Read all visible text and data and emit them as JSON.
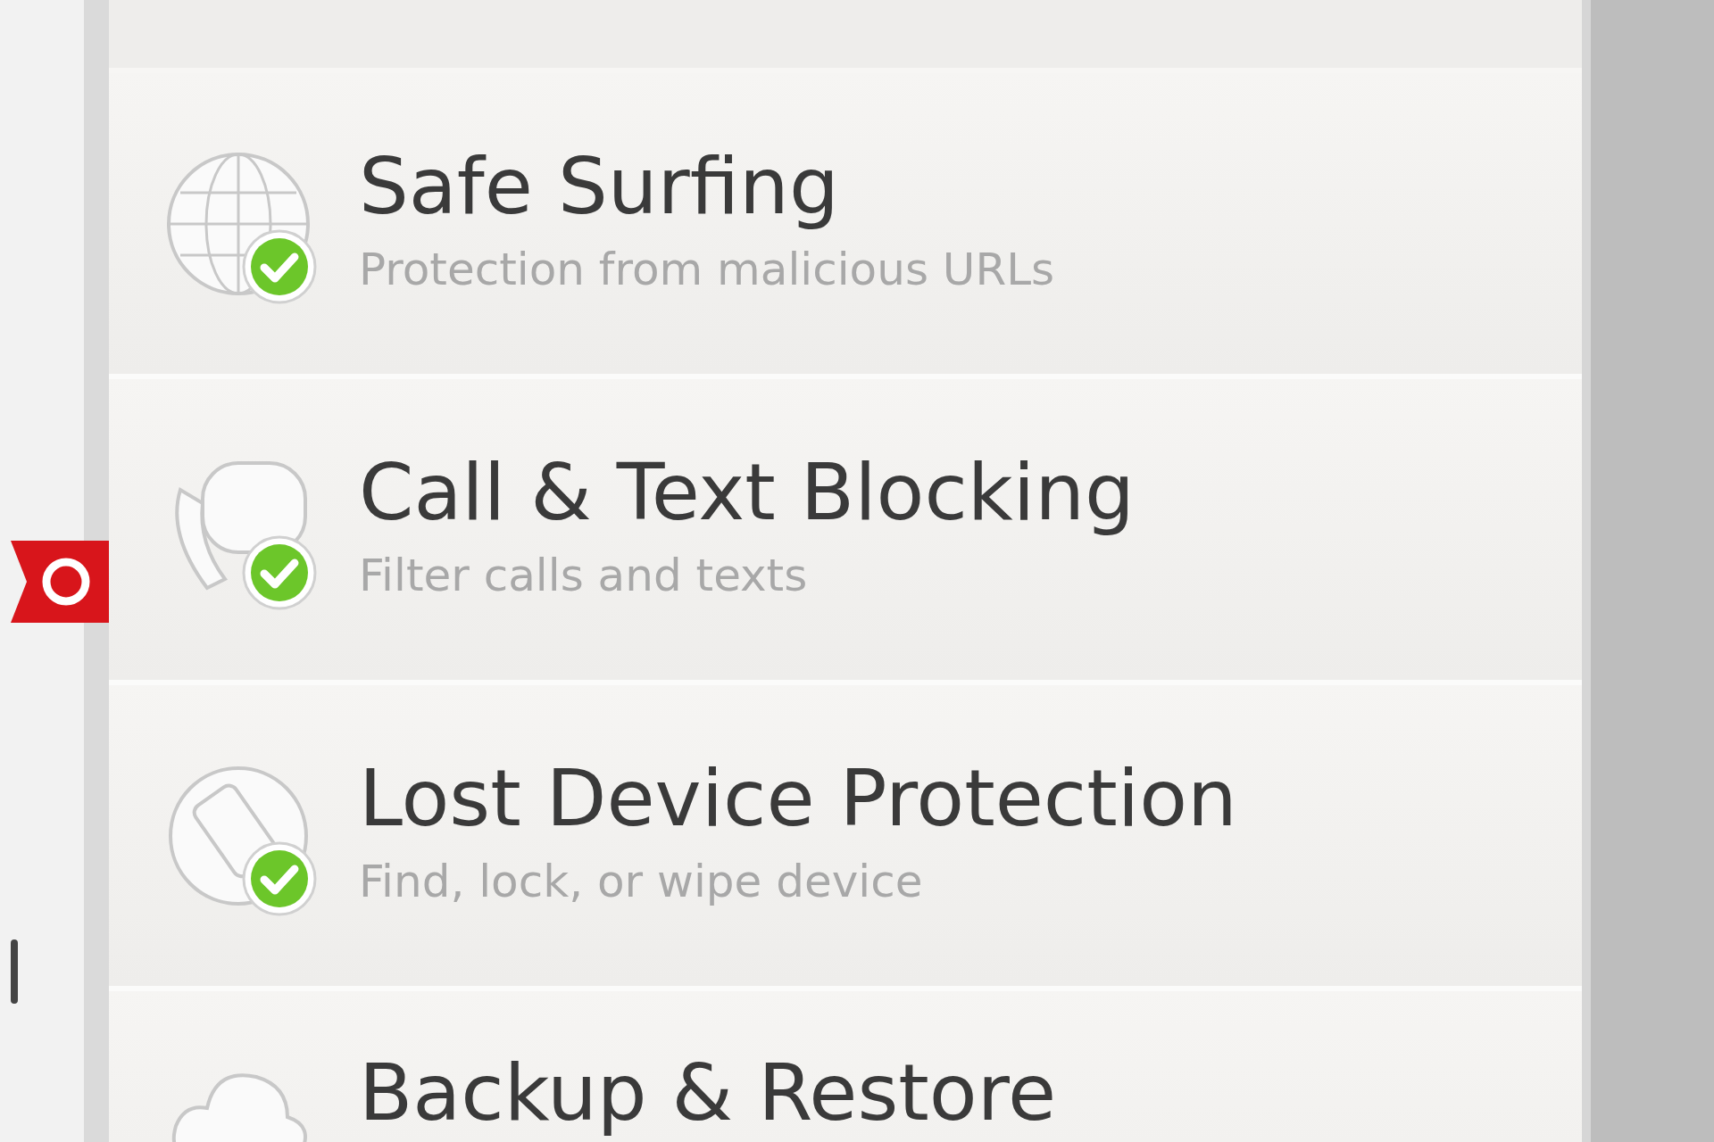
{
  "features": [
    {
      "kind": "globe",
      "title": "Safe Surfing",
      "subtitle": "Protection from malicious URLs",
      "protected": true
    },
    {
      "kind": "phone",
      "title": "Call & Text Blocking",
      "subtitle": "Filter calls and texts",
      "protected": true
    },
    {
      "kind": "device",
      "title": "Lost Device Protection",
      "subtitle": "Find, lock, or wipe device",
      "protected": true
    },
    {
      "kind": "cloud",
      "title": "Backup & Restore"
    }
  ]
}
